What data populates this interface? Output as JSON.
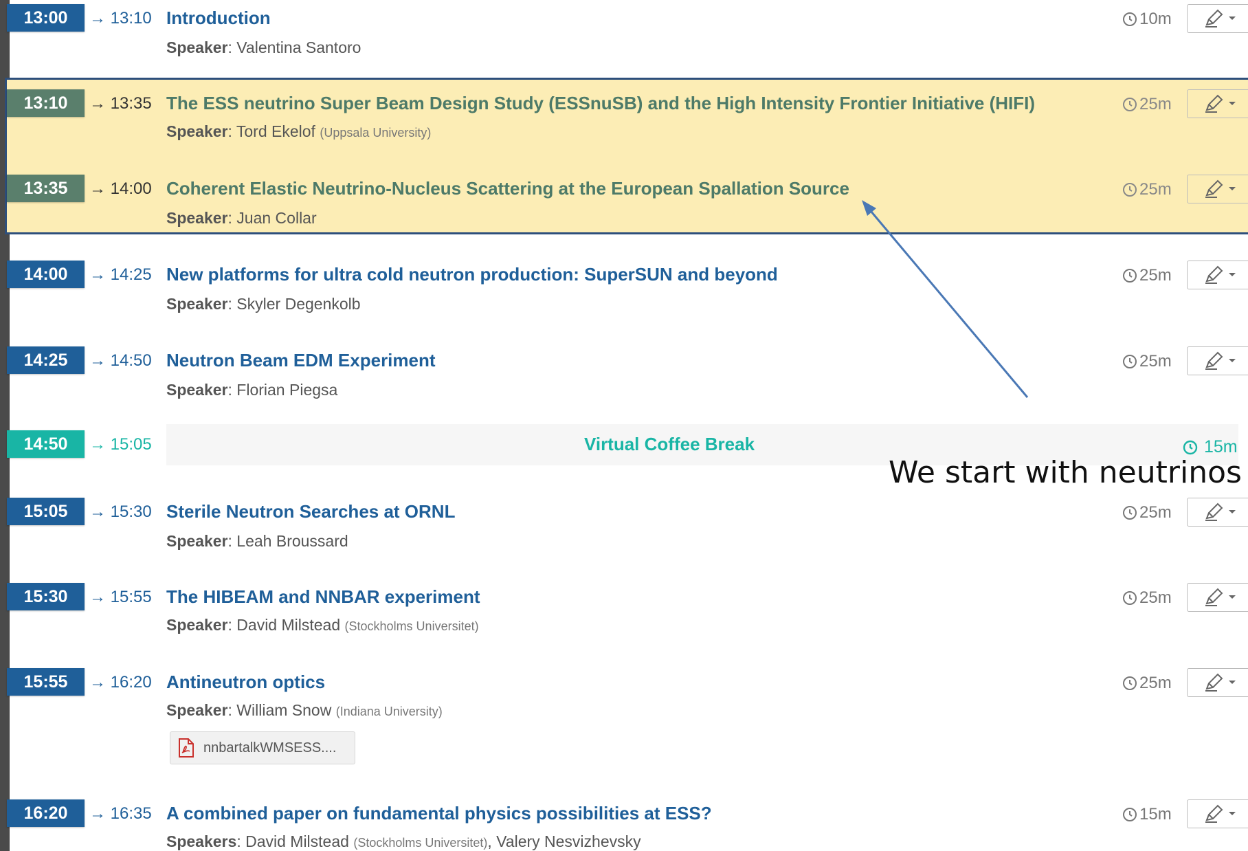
{
  "colors": {
    "primary": "#1f5f99",
    "highlight_bg": "#fcedb5",
    "highlight_border": "#2d4f7c",
    "break_teal": "#19b5a5",
    "arrow": "#4a78b5"
  },
  "icons": {
    "clock": "clock-icon",
    "edit": "pencil-icon",
    "dropdown": "caret-down-icon",
    "pdf": "pdf-file-icon"
  },
  "contributions": [
    {
      "start": "13:00",
      "end": "→ 13:10",
      "title": "Introduction",
      "speaker_label": "Speaker",
      "speaker": ": Valentina Santoro",
      "affiliation": "",
      "duration": "10m"
    },
    {
      "start": "13:10",
      "end": "→ 13:35",
      "title": "The ESS neutrino Super Beam Design Study (ESSnuSB) and the High Intensity Frontier Initiative (HIFI)",
      "speaker_label": "Speaker",
      "speaker": ": Tord Ekelof ",
      "affiliation": "(Uppsala University)",
      "duration": "25m"
    },
    {
      "start": "13:35",
      "end": "→ 14:00",
      "title": "Coherent Elastic Neutrino-Nucleus Scattering at the European Spallation Source",
      "speaker_label": "Speaker",
      "speaker": ": Juan Collar",
      "affiliation": "",
      "duration": "25m"
    },
    {
      "start": "14:00",
      "end": "→ 14:25",
      "title": "New platforms for ultra cold neutron production: SuperSUN and beyond",
      "speaker_label": "Speaker",
      "speaker": ": Skyler Degenkolb",
      "affiliation": "",
      "duration": "25m"
    },
    {
      "start": "14:25",
      "end": "→ 14:50",
      "title": "Neutron Beam EDM Experiment",
      "speaker_label": "Speaker",
      "speaker": ": Florian Piegsa",
      "affiliation": "",
      "duration": "25m"
    },
    {
      "start": "15:05",
      "end": "→ 15:30",
      "title": "Sterile Neutron Searches at ORNL",
      "speaker_label": "Speaker",
      "speaker": ": Leah Broussard",
      "affiliation": "",
      "duration": "25m"
    },
    {
      "start": "15:30",
      "end": "→ 15:55",
      "title": "The HIBEAM and NNBAR experiment",
      "speaker_label": "Speaker",
      "speaker": ": David Milstead ",
      "affiliation": "(Stockholms Universitet)",
      "duration": "25m"
    },
    {
      "start": "15:55",
      "end": "→ 16:20",
      "title": "Antineutron optics",
      "speaker_label": "Speaker",
      "speaker": ": William Snow ",
      "affiliation": "(Indiana University)",
      "duration": "25m"
    },
    {
      "start": "16:20",
      "end": "→ 16:35",
      "title": "A combined paper on fundamental physics possibilities at ESS?",
      "speaker_label": "Speakers",
      "speaker": ": David Milstead ",
      "affiliation": "(Stockholms Universitet)",
      "speaker2": ", Valery Nesvizhevsky",
      "duration": "15m"
    }
  ],
  "break": {
    "start": "14:50",
    "end": "→ 15:05",
    "title": "Virtual Coffee Break",
    "duration": "15m"
  },
  "attachment": {
    "filename": "nnbartalkWMSESS...."
  },
  "annotation": {
    "text": "We start with neutrinos"
  }
}
